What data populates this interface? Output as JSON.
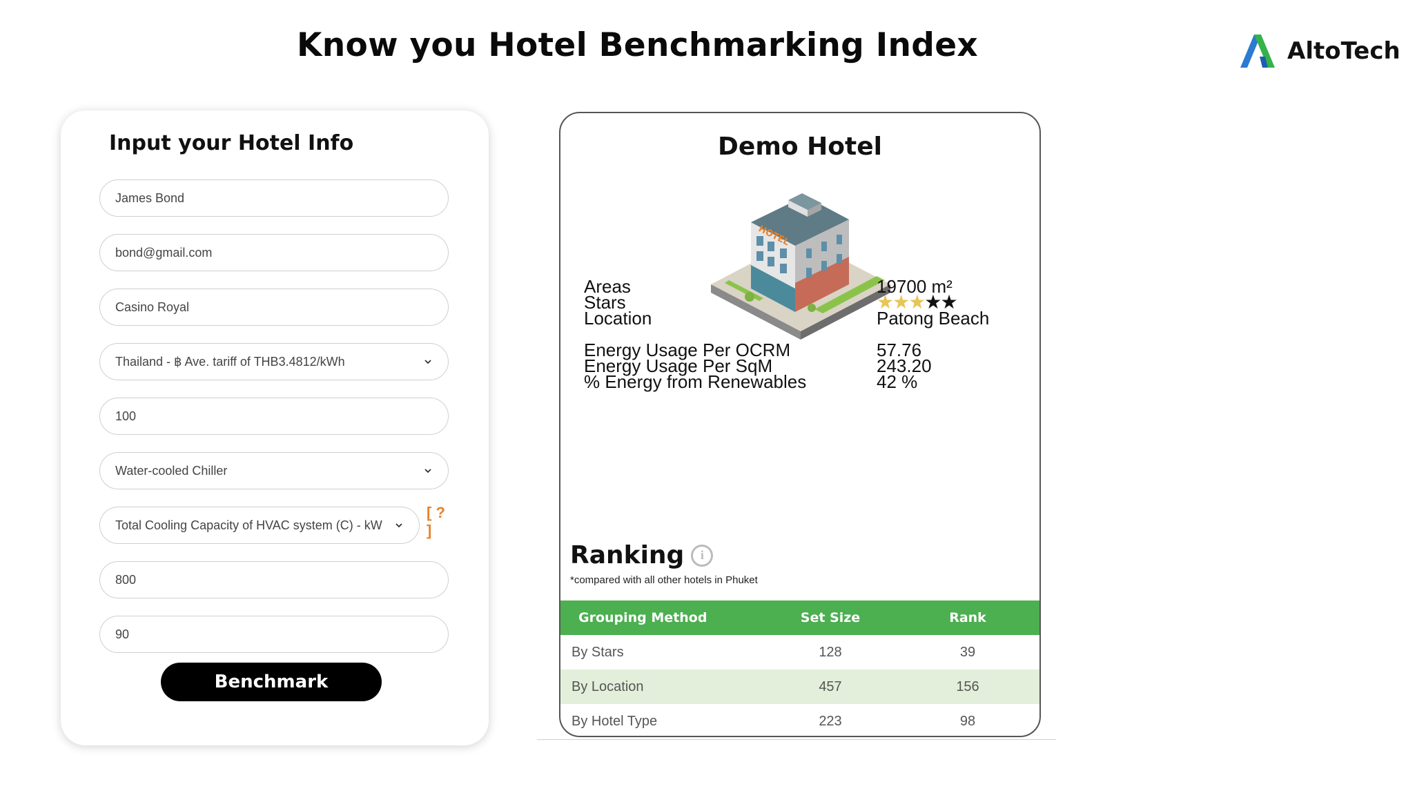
{
  "page": {
    "title": "Know you Hotel Benchmarking Index"
  },
  "brand": {
    "logo_text": "AltoTech",
    "accent_colors": [
      "#2a7bd1",
      "#35b34a"
    ]
  },
  "form": {
    "title": "Input your Hotel Info",
    "name_value": "James Bond",
    "email_value": "bond@gmail.com",
    "hotel_value": "Casino Royal",
    "country_select": "Thailand - ฿ Ave. tariff of THB3.4812/kWh",
    "rooms_value": "100",
    "hvac_type_select": "Water-cooled Chiller",
    "capacity_select": "Total Cooling Capacity of HVAC system (C) - kW",
    "help_label": "[ ? ]",
    "capacity_value": "800",
    "occupancy_value": "90",
    "submit_label": "Benchmark"
  },
  "result": {
    "hotel_name": "Demo Hotel",
    "image_icon": "isometric-hotel-building-icon",
    "details": [
      {
        "label": "Areas",
        "value": "19700 m²"
      },
      {
        "label": "Stars",
        "stars_filled": 3,
        "stars_total": 5
      },
      {
        "label": "Location",
        "value": "Patong Beach"
      }
    ],
    "metrics": [
      {
        "label": "Energy Usage Per OCRM",
        "value": "57.76"
      },
      {
        "label": "Energy Usage Per SqM",
        "value": "243.20"
      },
      {
        "label": "% Energy from Renewables",
        "value": "42 %"
      }
    ],
    "ranking": {
      "title": "Ranking",
      "note": "*compared with all other hotels in Phuket",
      "header_color": "#4caf50",
      "columns": [
        "Grouping Method",
        "Set Size",
        "Rank"
      ],
      "rows": [
        [
          "By Stars",
          "128",
          "39"
        ],
        [
          "By Location",
          "457",
          "156"
        ],
        [
          "By Hotel Type",
          "223",
          "98"
        ]
      ]
    }
  }
}
